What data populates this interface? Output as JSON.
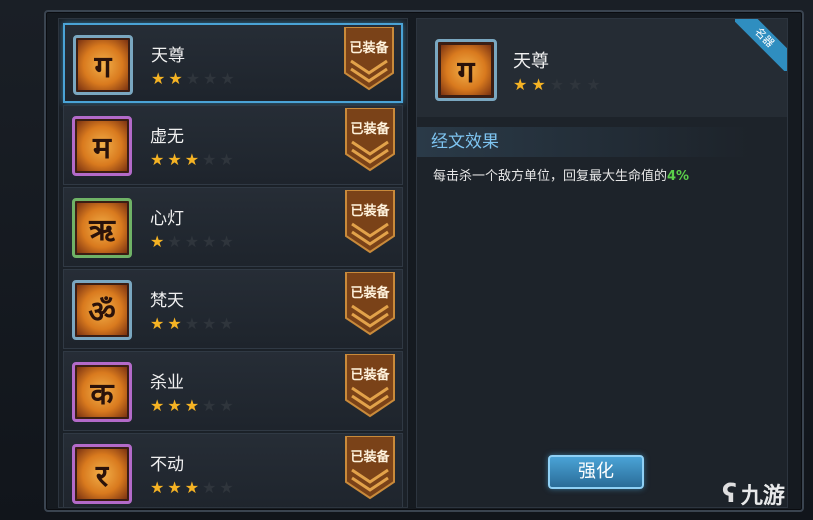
{
  "scripture_list": [
    {
      "name": "天尊",
      "glyph": "ग",
      "stars_on": 2,
      "stars_total": 5,
      "badge": "已装备",
      "tier": "blue",
      "selected": true
    },
    {
      "name": "虚无",
      "glyph": "म",
      "stars_on": 3,
      "stars_total": 5,
      "badge": "已装备",
      "tier": "purple",
      "selected": false
    },
    {
      "name": "心灯",
      "glyph": "ऋ",
      "stars_on": 1,
      "stars_total": 5,
      "badge": "已装备",
      "tier": "green",
      "selected": false
    },
    {
      "name": "梵天",
      "glyph": "ॐ",
      "stars_on": 2,
      "stars_total": 5,
      "badge": "已装备",
      "tier": "blue",
      "selected": false
    },
    {
      "name": "杀业",
      "glyph": "क",
      "stars_on": 3,
      "stars_total": 5,
      "badge": "已装备",
      "tier": "purple",
      "selected": false
    },
    {
      "name": "不动",
      "glyph": "र",
      "stars_on": 3,
      "stars_total": 5,
      "badge": "已装备",
      "tier": "purple",
      "selected": false
    }
  ],
  "detail": {
    "name": "天尊",
    "glyph": "ग",
    "stars_on": 2,
    "stars_total": 5,
    "ribbon": "名器",
    "section_title": "经文效果",
    "effect_prefix": "每击杀一个敌方单位，回复最大生命值的",
    "effect_value": "4%"
  },
  "upgrade_button": "强化",
  "watermark": {
    "logo": "ʕ",
    "text": "九游"
  },
  "colors": {
    "star_on": "#f5b324",
    "star_off": "#2f353c",
    "accent": "#4aa3d6",
    "highlight": "#5bd04a"
  }
}
